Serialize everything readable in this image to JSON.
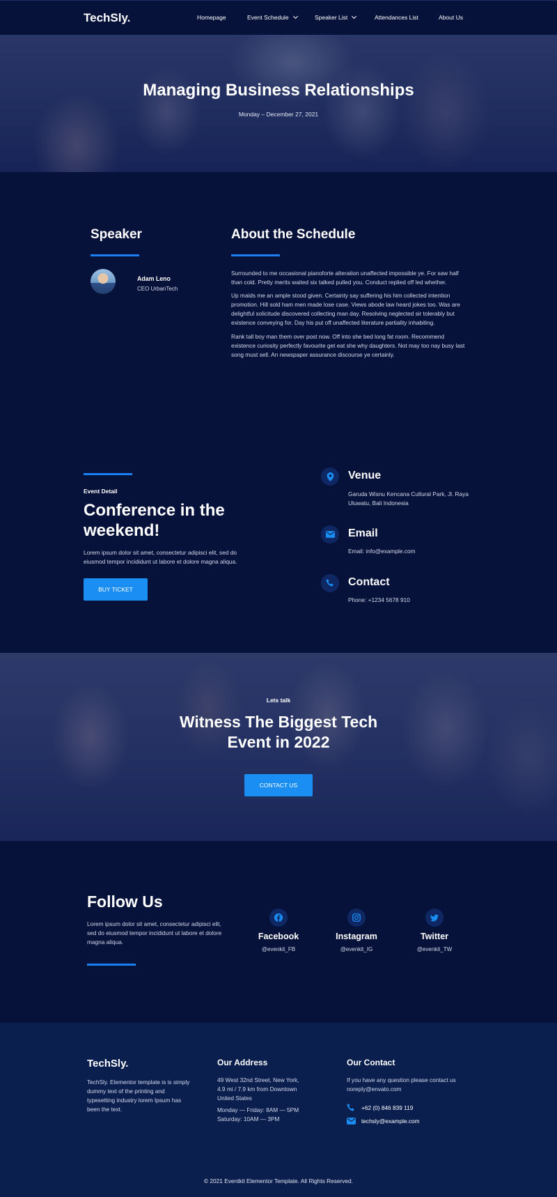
{
  "brand": "TechSly.",
  "nav": {
    "homepage": "Homepage",
    "event_schedule": "Event Schedule",
    "speaker_list": "Speaker List",
    "attendances_list": "Attendances List",
    "about_us": "About Us"
  },
  "hero": {
    "title": "Managing Business Relationships",
    "date": "Monday – December 27, 2021"
  },
  "speaker": {
    "heading": "Speaker",
    "name": "Adam Leno",
    "role": "CEO UrbanTech"
  },
  "about": {
    "heading": "About the Schedule",
    "p1": "Surrounded to me occasional pianoforte alteration unaffected impossible ye. For saw half than cold. Pretty merits waited six talked pulled you. Conduct replied off led whether.",
    "p2": "Up maids me an ample stood given. Certainty say suffering his him collected intention promotion. Hill sold ham men made lose case. Views abode law heard jokes too. Was are delightful solicitude discovered collecting man day. Resolving neglected sir tolerably but existence conveying for. Day his put off unaffected literature partiality inhabiting.",
    "p3": "Rank tall boy man them over post now. Off into she bed long fat room. Recommend existence curiosity perfectly favourite get eat she why daughters. Not may too nay busy last song must sell. An newspaper assurance discourse ye certainly."
  },
  "event": {
    "kicker": "Event Detail",
    "title": "Conference in the weekend!",
    "text": "Lorem ipsum dolor sit amet, consectetur adipisci elit, sed do eiusmod tempor incididunt ut labore et dolore magna aliqua.",
    "button": "BUY TICKET",
    "venue_heading": "Venue",
    "venue_text": "Garuda Wisnu Kencana Cultural Park, Jl. Raya Uluwatu, Bali Indonesia",
    "email_heading": "Email",
    "email_text": "Email: info@example.com",
    "contact_heading": "Contact",
    "contact_text": "Phone: +1234 5678 910"
  },
  "cta": {
    "kicker": "Lets talk",
    "title": "Witness The Biggest Tech Event in 2022",
    "button": "CONTACT US"
  },
  "follow": {
    "heading": "Follow Us",
    "text": "Lorem ipsum dolor sit amet, consectetur adipisci elit, sed do eiusmod tempor incididunt ut labore et dolore magna aliqua.",
    "facebook": {
      "name": "Facebook",
      "handle": "@evenkit_FB"
    },
    "instagram": {
      "name": "Instagram",
      "handle": "@evenkit_IG"
    },
    "twitter": {
      "name": "Twitter",
      "handle": "@evenkit_TW"
    }
  },
  "footer": {
    "brand": "TechSly.",
    "brand_text": "TechSly. Elementor template is is simply dummy text of the printing and typesetting industry lorem Ipsum has been the text.",
    "address_heading": "Our Address",
    "address_text": "49 West 32nd Street, New York, 4.9 mi / 7.9 km from Downtown United States",
    "hours_text": "Monday — Friday: 8AM — 5PM Saturday: 10AM — 3PM",
    "contact_heading": "Our Contact",
    "contact_text": "If you have any question please contact us noreply@envato.com",
    "phone": "+62 (0) 846 839 119",
    "email": "techsly@example.com",
    "copyright": "© 2021 Eventkit Elementor Template. All Rights Reserved."
  },
  "colors": {
    "background": "#07123a",
    "footer_background": "#0b1f4f",
    "accent": "#1a8ef2",
    "icon_circle": "#0f2763"
  }
}
